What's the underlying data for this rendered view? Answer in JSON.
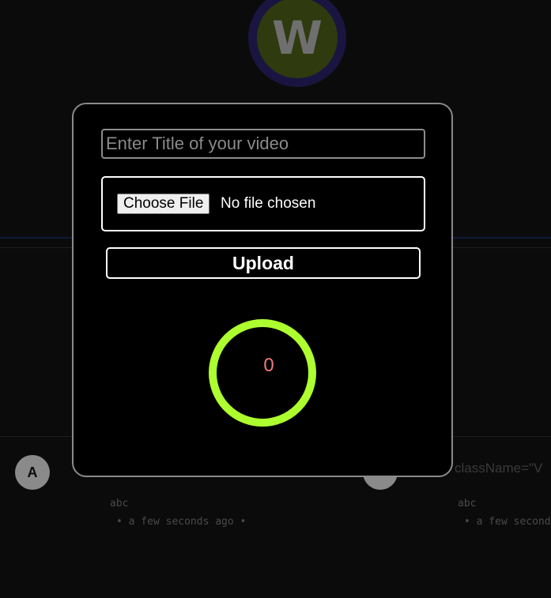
{
  "channel": {
    "avatar_letter": "W"
  },
  "upload_modal": {
    "title_placeholder": "Enter Title of your video",
    "title_value": "",
    "file_button_label": "Choose File",
    "file_status": "No file chosen",
    "upload_label": "Upload",
    "progress_value": "0",
    "progress_fraction": 0,
    "ring_color": "#adff2f"
  },
  "video_cards": [
    {
      "avatar_letter": "A",
      "title": "abc",
      "meta": "• a few seconds ago •"
    },
    {
      "avatar_letter": "A",
      "title": "abc",
      "meta": "• a few seconds ago •",
      "code_fragment": "className=\"V"
    }
  ],
  "colors": {
    "background": "#0b0b0b",
    "modal_background": "#000000",
    "modal_border": "#8a8a8a",
    "progress_text": "#f07a7a"
  }
}
